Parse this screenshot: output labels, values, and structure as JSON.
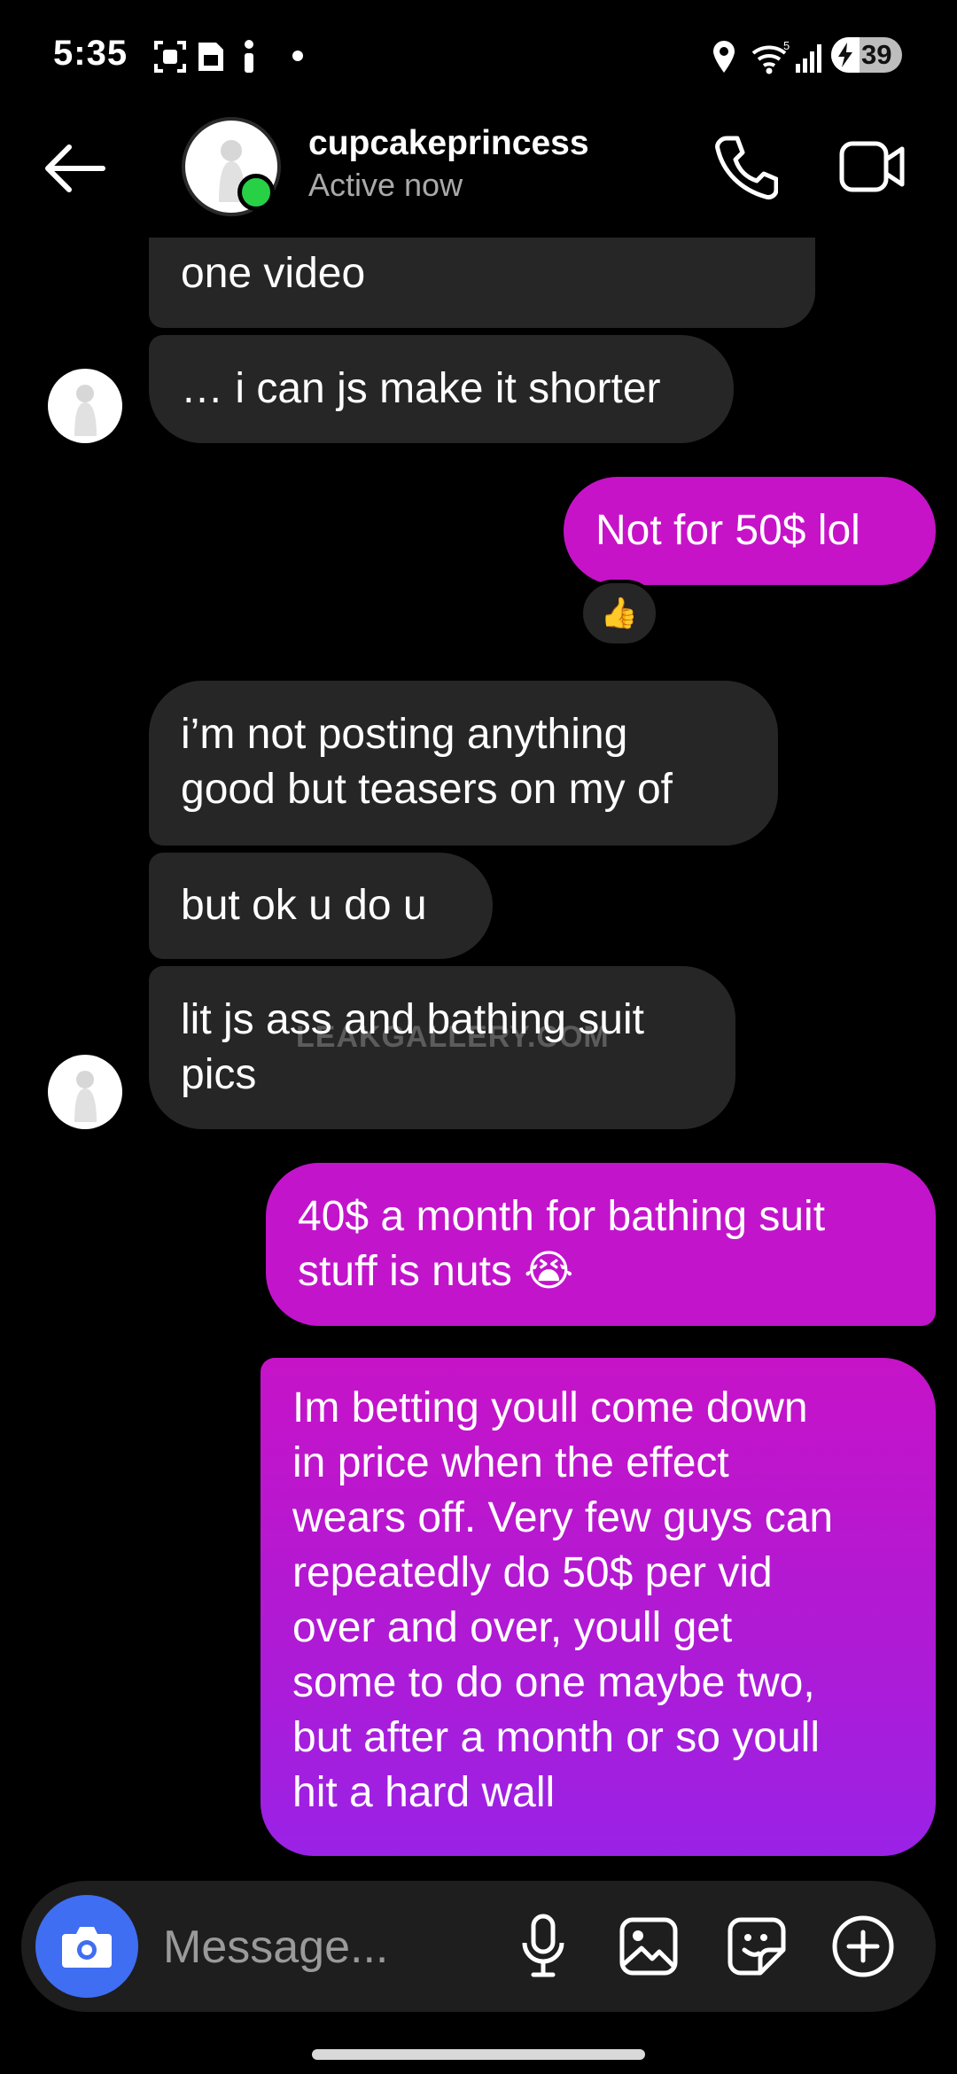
{
  "status_bar": {
    "time": "5:35",
    "battery": "39"
  },
  "header": {
    "contact_name": "cupcakeprincess",
    "status": "Active now"
  },
  "messages": [
    {
      "text": "one video"
    },
    {
      "text": "… i can js make it shorter"
    },
    {
      "text": "Not for 50$ lol",
      "reaction": "👍"
    },
    {
      "line1": "i’m not posting anything",
      "line2": "good but teasers on my of"
    },
    {
      "text": "but ok u do u"
    },
    {
      "line1": "lit js ass and bathing suit",
      "line2": "pics"
    },
    {
      "line1": "40$ a month for bathing suit",
      "line2": "stuff is nuts 😭"
    },
    {
      "lines": [
        "Im betting youll come down",
        "in price when the effect",
        "wears off. Very few guys can",
        "repeatedly do 50$ per vid",
        "over and over, youll get",
        "some to do one maybe two,",
        "but after a month or so youll",
        "hit a hard wall"
      ]
    }
  ],
  "watermark": "LEAKGALLERY.COM",
  "composer": {
    "placeholder": "Message..."
  },
  "colors": {
    "background": "#000000",
    "incoming_bubble": "#262626",
    "outgoing_bubble_top": "#c613c8",
    "outgoing_bubble_bottom": "#9a22e6",
    "online": "#27d045",
    "camera_button": "#3f6ef2"
  },
  "icons": {
    "status_bar": [
      "screenshot-icon",
      "sim-icon",
      "info-icon",
      "dot-icon",
      "location-icon",
      "wifi-icon",
      "signal-icon",
      "battery-icon"
    ],
    "header": [
      "back-arrow-icon",
      "phone-icon",
      "video-camera-icon"
    ],
    "composer": [
      "camera-icon",
      "microphone-icon",
      "gallery-icon",
      "sticker-icon",
      "plus-circle-icon"
    ]
  }
}
